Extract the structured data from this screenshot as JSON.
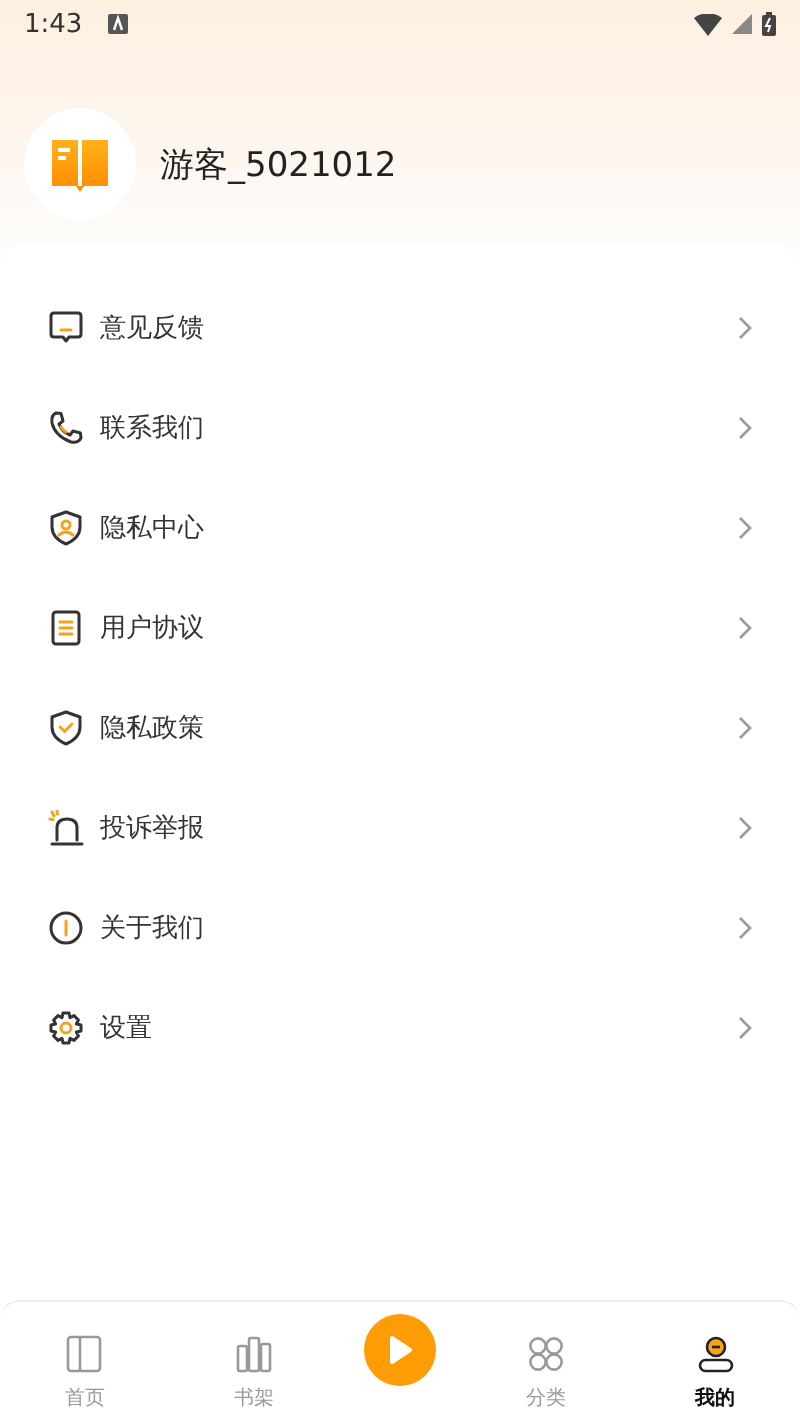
{
  "status_bar": {
    "time": "1:43"
  },
  "profile": {
    "username": "游客_5021012"
  },
  "menu": [
    {
      "label": "意见反馈"
    },
    {
      "label": "联系我们"
    },
    {
      "label": "隐私中心"
    },
    {
      "label": "用户协议"
    },
    {
      "label": "隐私政策"
    },
    {
      "label": "投诉举报"
    },
    {
      "label": "关于我们"
    },
    {
      "label": "设置"
    }
  ],
  "bottom_nav": [
    {
      "label": "首页",
      "selected": false
    },
    {
      "label": "书架",
      "selected": false
    },
    {
      "label": "分类",
      "selected": false
    },
    {
      "label": "我的",
      "selected": true
    }
  ]
}
